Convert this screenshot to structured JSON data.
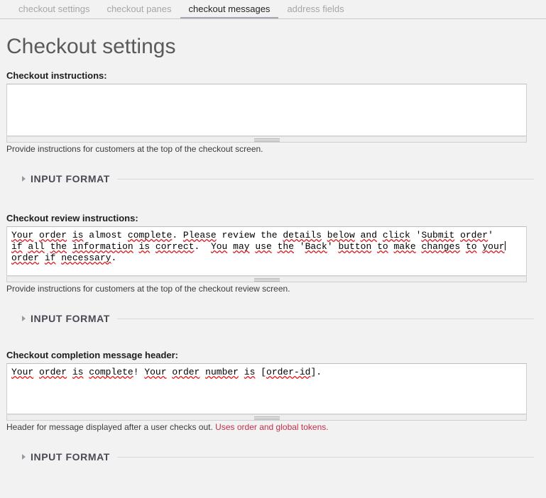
{
  "tabs": [
    {
      "label": "checkout settings",
      "active": false
    },
    {
      "label": "checkout panes",
      "active": false
    },
    {
      "label": "checkout messages",
      "active": true
    },
    {
      "label": "address fields",
      "active": false
    }
  ],
  "page": {
    "title": "Checkout settings"
  },
  "fields": [
    {
      "label": "Checkout instructions:",
      "value": "",
      "description": "Provide instructions for customers at the top of the checkout screen.",
      "link_text": "",
      "format_legend": "INPUT FORMAT"
    },
    {
      "label": "Checkout review instructions:",
      "value": "Your order is almost complete. Please review the details below and click 'Submit order' if all the information is correct.  You may use the 'Back' button to make changes to your order if necessary.",
      "description": "Provide instructions for customers at the top of the checkout review screen.",
      "link_text": "",
      "format_legend": "INPUT FORMAT"
    },
    {
      "label": "Checkout completion message header:",
      "value": "Your order is complete! Your order number is [order-id].",
      "description": "Header for message displayed after a user checks out.",
      "link_text": "Uses order and global tokens.",
      "format_legend": "INPUT FORMAT"
    }
  ],
  "colors": {
    "page_background": "#f2f2f2",
    "active_tab_text": "#232323",
    "inactive_tab_text": "#a6a6a6",
    "heading_text": "#5a5a5a",
    "token_link": "#c0304a",
    "spellcheck_underline": "#e01b1b",
    "legend_text": "#4a4a55"
  }
}
